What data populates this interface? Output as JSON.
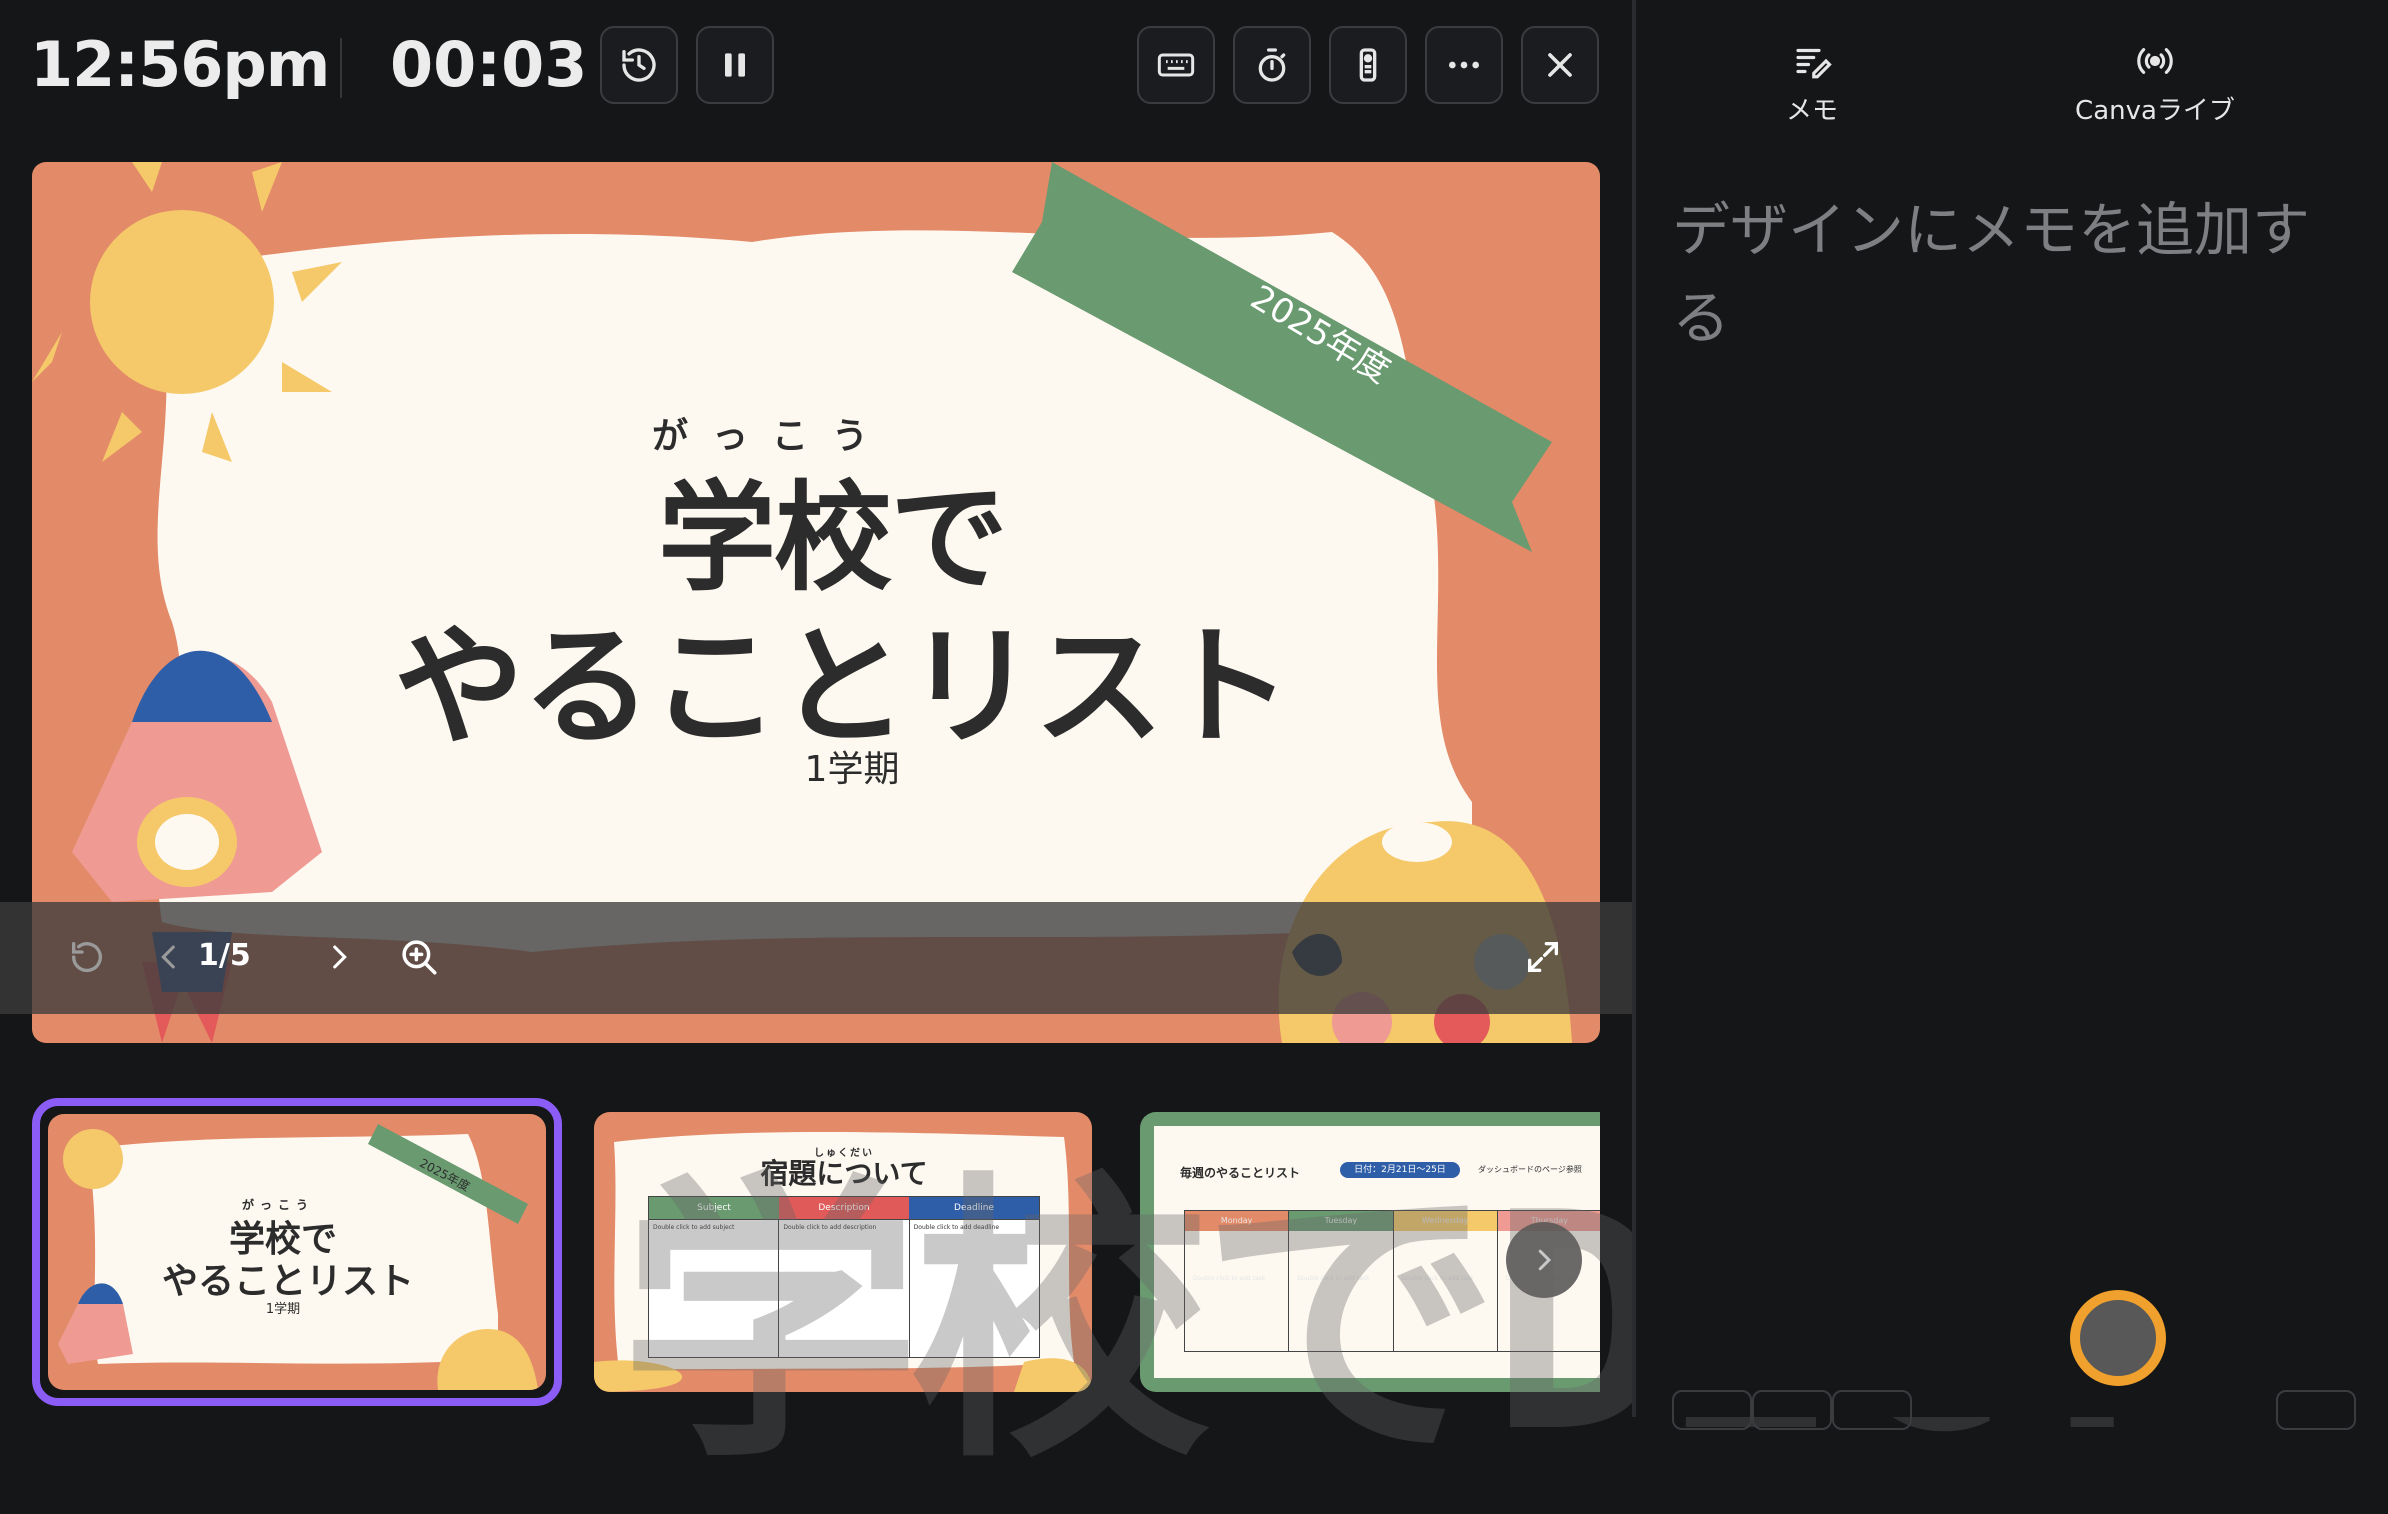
{
  "topbar": {
    "clock": "12:56pm",
    "timer": "00:03"
  },
  "slide": {
    "furigana": "がっこう",
    "title_line1": "学校で",
    "title_line2": "やることリスト",
    "subtitle": "1学期",
    "banner": "2025年度"
  },
  "controls": {
    "page_indicator": "1/5"
  },
  "thumbnails": [
    {
      "furigana": "がっこう",
      "title1": "学校で",
      "title2": "やることリスト",
      "subtitle": "1学期",
      "banner": "2025年度"
    },
    {
      "furigana": "しゅくだい",
      "title": "宿題について",
      "headers": [
        "Subject",
        "Description",
        "Deadline"
      ],
      "cells": [
        "Double click to add subject",
        "Double click to add description",
        "Double click to add deadline"
      ]
    },
    {
      "title": "毎週のやることリスト",
      "tag": "日付：2月21日〜25日",
      "note": "ダッシュボードのページ参照",
      "days": [
        "Monday",
        "Tuesday",
        "Wednesday",
        "Thursday"
      ],
      "cell": "Double click to add task"
    }
  ],
  "right_panel": {
    "tabs": [
      {
        "label": "メモ",
        "icon": "notes-icon"
      },
      {
        "label": "Canvaライブ",
        "icon": "broadcast-icon"
      }
    ],
    "placeholder": "デザインにメモを追加する"
  },
  "watermark": "学校でDICT",
  "colors": {
    "background": "#151618",
    "slide_bg": "#e38a68",
    "paper": "#fdf9f1",
    "banner_green": "#6a9a70",
    "sun_yellow": "#f5c96a",
    "selection": "#8b5cf6",
    "rocket_blue": "#2f5ea8",
    "rocket_pink": "#ef9a92"
  }
}
